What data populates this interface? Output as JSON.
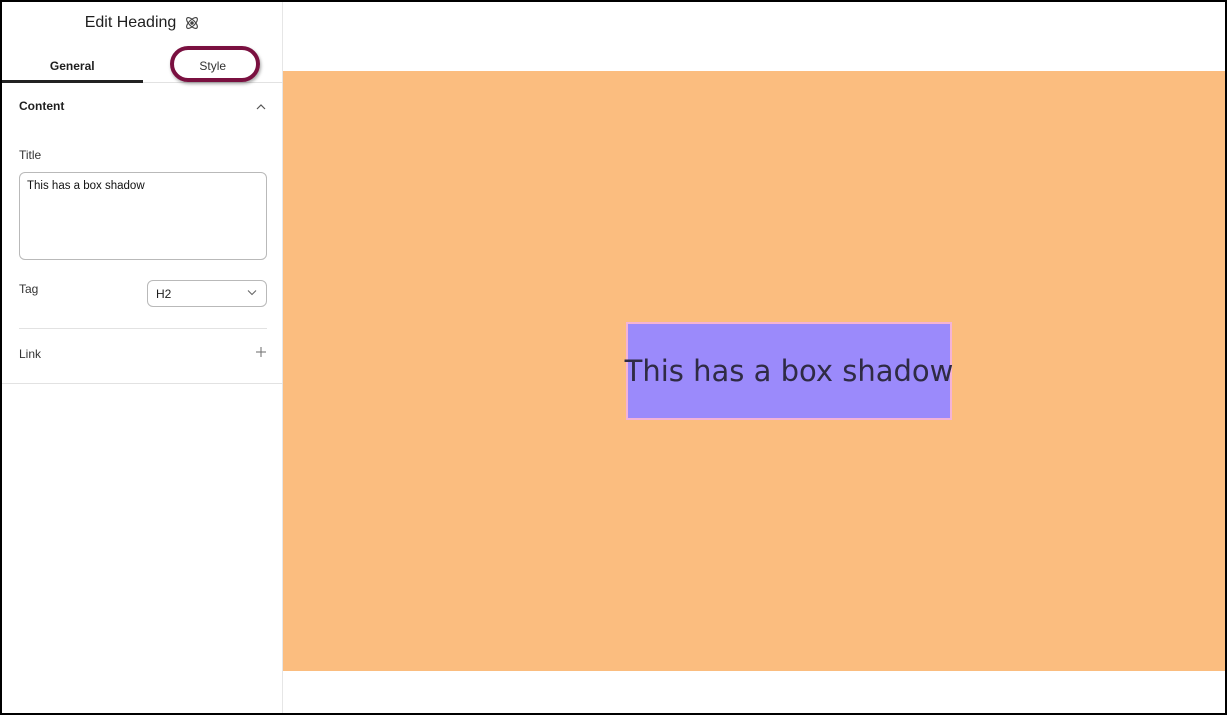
{
  "panel": {
    "title": "Edit Heading",
    "title_icon": "atom-icon"
  },
  "tabs": [
    {
      "label": "General",
      "active": true
    },
    {
      "label": "Style",
      "active": false,
      "highlighted": true
    }
  ],
  "content_section": {
    "title": "Content",
    "expanded": true,
    "title_field": {
      "label": "Title",
      "value": "This has a box shadow"
    },
    "tag_field": {
      "label": "Tag",
      "selected": "H2"
    },
    "link_field": {
      "label": "Link"
    }
  },
  "canvas": {
    "heading_text": "This has a box shadow",
    "background_color": "#fbbd7f",
    "heading_bg_color": "#9b8afb",
    "heading_border_color": "#f4b3d6"
  },
  "accent": {
    "highlight_ring_color": "#7a1040"
  }
}
